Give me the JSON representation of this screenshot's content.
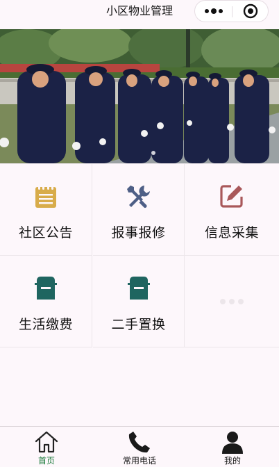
{
  "navbar": {
    "title": "小区物业管理",
    "more_icon": "more-dots-icon",
    "close_icon": "target-close-icon"
  },
  "banner": {
    "image": "security-guards-marching-photo"
  },
  "grid": {
    "items": [
      {
        "label": "社区公告",
        "icon": "notepad-icon",
        "color": "#d8ac4a"
      },
      {
        "label": "报事报修",
        "icon": "tools-icon",
        "color": "#4e5f86"
      },
      {
        "label": "信息采集",
        "icon": "edit-icon",
        "color": "#a9585a"
      },
      {
        "label": "生活缴费",
        "icon": "mailbox-icon",
        "color": "#1f6560"
      },
      {
        "label": "二手置换",
        "icon": "mailbox-icon",
        "color": "#1f6560"
      },
      {
        "label": "",
        "icon": "loading-dots-icon",
        "color": "#ece6ea"
      }
    ]
  },
  "tabbar": {
    "tabs": [
      {
        "label": "首页",
        "icon": "home-icon",
        "active": true
      },
      {
        "label": "常用电话",
        "icon": "phone-icon",
        "active": false
      },
      {
        "label": "我的",
        "icon": "user-icon",
        "active": false
      }
    ],
    "active_color": "#1a7a3a"
  }
}
